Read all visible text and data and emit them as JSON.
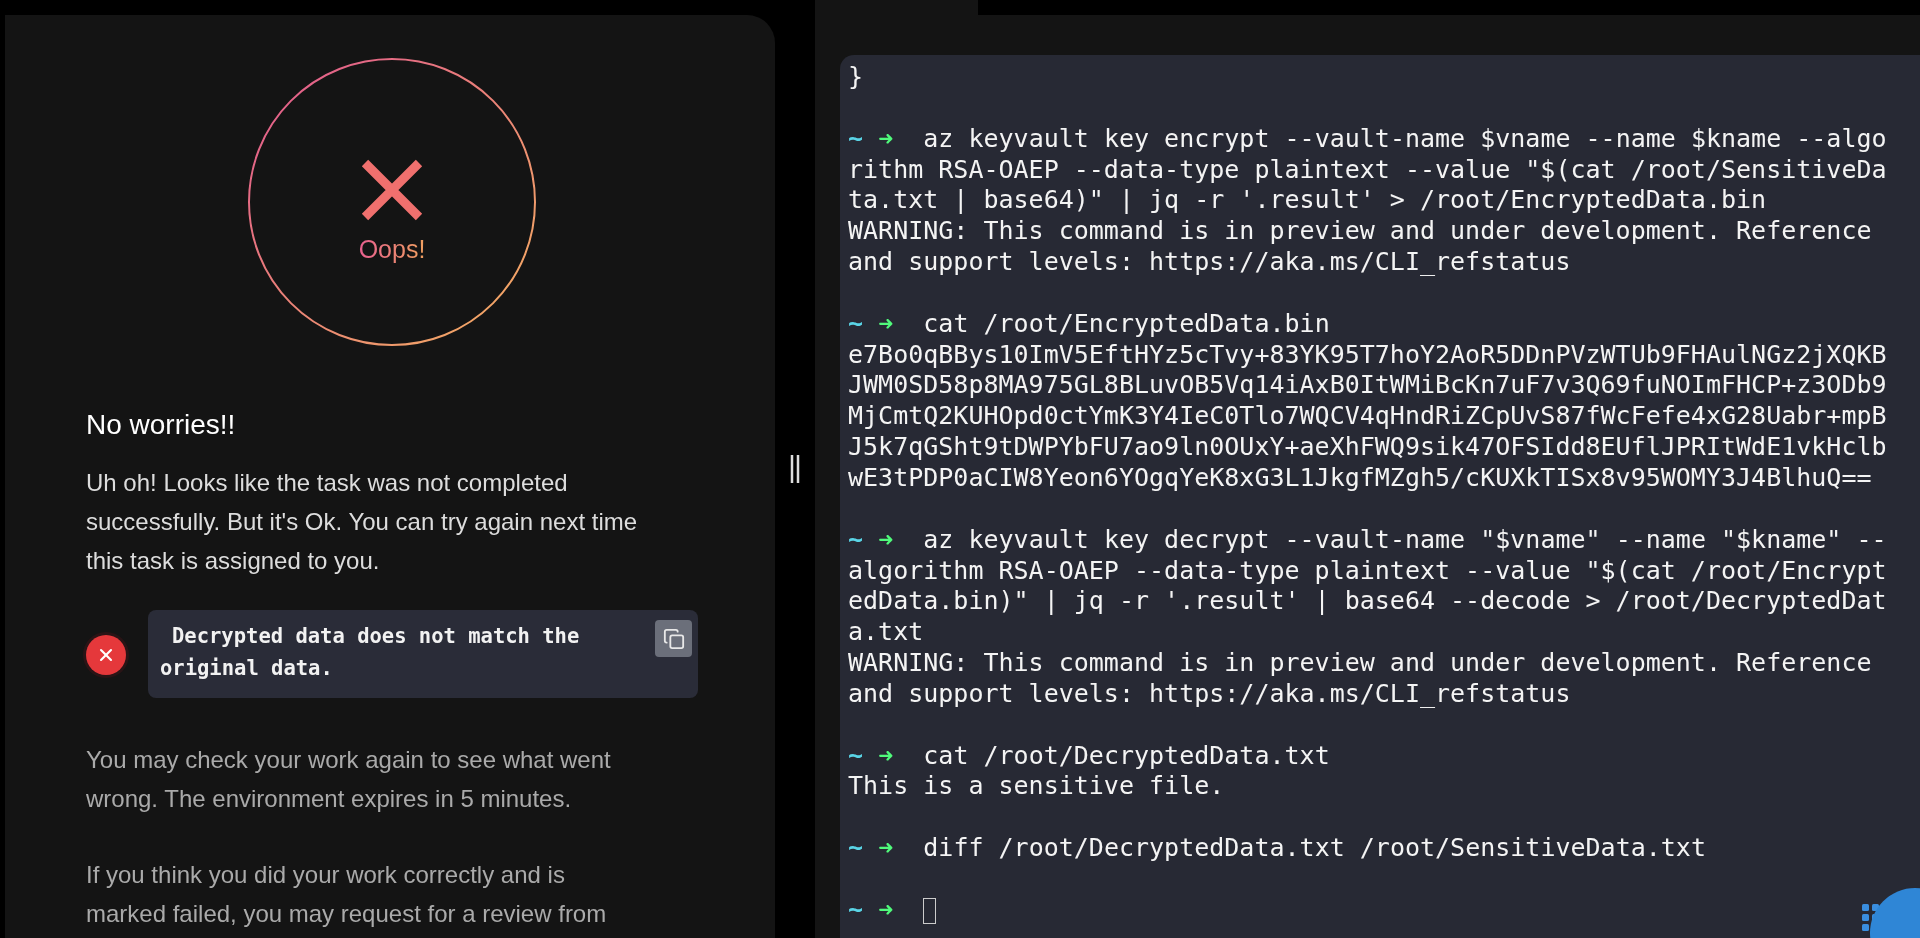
{
  "result": {
    "title": "Oops!"
  },
  "message": {
    "heading": "No worries!!",
    "body": "Uh oh! Looks like the task was not completed successfully. But it's Ok. You can try again next time this task is assigned to you."
  },
  "checks": [
    {
      "passed": false,
      "text": "Decrypted data does not match the original data."
    }
  ],
  "notes": [
    "You may check your work again to see what went wrong. The environment expires in 5 minutes.",
    "If you think you did your work correctly and is marked failed, you may request for a review from"
  ],
  "terminal": {
    "prompt": {
      "tilde": "~",
      "arrow": "➜"
    },
    "lines": [
      {
        "kind": "text",
        "text": "}"
      },
      {
        "kind": "blank"
      },
      {
        "kind": "prompt",
        "text": "az keyvault key encrypt --vault-name $vname --name $kname --algo"
      },
      {
        "kind": "text",
        "text": "rithm RSA-OAEP --data-type plaintext --value \"$(cat /root/SensitiveDa"
      },
      {
        "kind": "text",
        "text": "ta.txt | base64)\" | jq -r '.result' > /root/EncryptedData.bin"
      },
      {
        "kind": "text",
        "text": "WARNING: This command is in preview and under development. Reference"
      },
      {
        "kind": "text",
        "text": "and support levels: https://aka.ms/CLI_refstatus"
      },
      {
        "kind": "blank"
      },
      {
        "kind": "prompt",
        "text": "cat /root/EncryptedData.bin"
      },
      {
        "kind": "text",
        "text": "e7Bo0qBBys10ImV5EftHYz5cTvy+83YK95T7hoY2AoR5DDnPVzWTUb9FHAulNGz2jXQKB"
      },
      {
        "kind": "text",
        "text": "JWM0SD58p8MA975GL8BLuvOB5Vq14iAxB0ItWMiBcKn7uF7v3Q69fuNOImFHCP+z3ODb9"
      },
      {
        "kind": "text",
        "text": "MjCmtQ2KUHOpd0ctYmK3Y4IeC0Tlo7WQCV4qHndRiZCpUvS87fWcFefe4xG28Uabr+mpB"
      },
      {
        "kind": "text",
        "text": "J5k7qGSht9tDWPYbFU7ao9ln0OUxY+aeXhFWQ9sik47OFSIdd8EUflJPRItWdE1vkHclb"
      },
      {
        "kind": "text",
        "text": "wE3tPDP0aCIW8Yeon6YOgqYeK8xG3L1JkgfMZgh5/cKUXkTISx8v95WOMY3J4BlhuQ=="
      },
      {
        "kind": "blank"
      },
      {
        "kind": "prompt",
        "text": "az keyvault key decrypt --vault-name \"$vname\" --name \"$kname\" --"
      },
      {
        "kind": "text",
        "text": "algorithm RSA-OAEP --data-type plaintext --value \"$(cat /root/Encrypt"
      },
      {
        "kind": "text",
        "text": "edData.bin)\" | jq -r '.result' | base64 --decode > /root/DecryptedDat"
      },
      {
        "kind": "text",
        "text": "a.txt"
      },
      {
        "kind": "text",
        "text": "WARNING: This command is in preview and under development. Reference"
      },
      {
        "kind": "text",
        "text": "and support levels: https://aka.ms/CLI_refstatus"
      },
      {
        "kind": "blank"
      },
      {
        "kind": "prompt",
        "text": "cat /root/DecryptedData.txt"
      },
      {
        "kind": "text",
        "text": "This is a sensitive file."
      },
      {
        "kind": "blank"
      },
      {
        "kind": "prompt",
        "text": "diff /root/DecryptedData.txt /root/SensitiveData.txt"
      },
      {
        "kind": "blank"
      },
      {
        "kind": "prompt",
        "cursor": true
      }
    ]
  }
}
